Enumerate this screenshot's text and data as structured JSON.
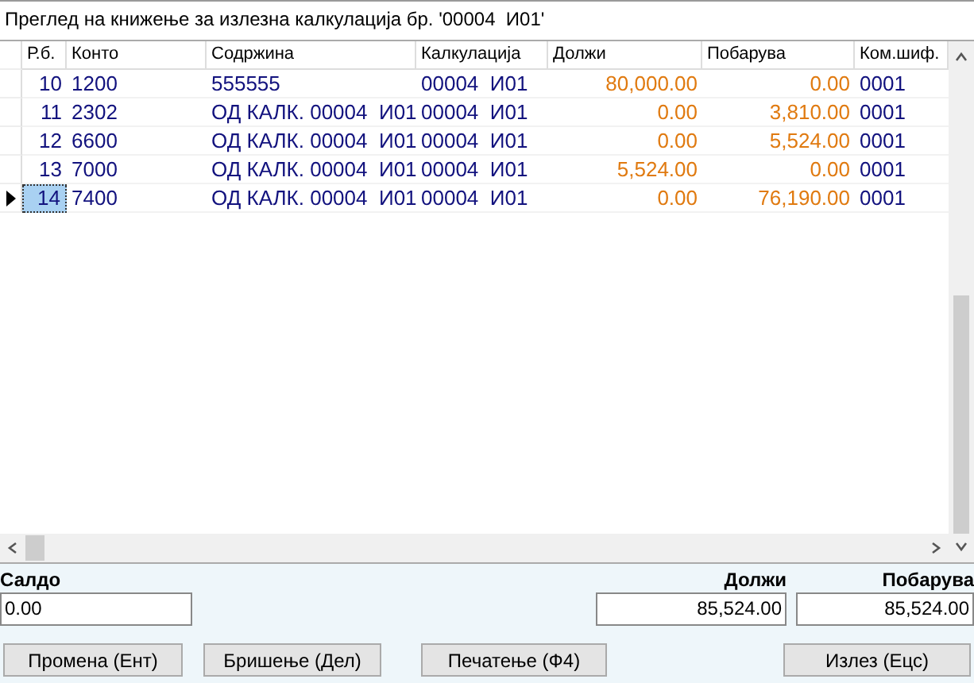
{
  "title": "Преглед на книжење за излезна калкулација бр. '00004  И01'",
  "table": {
    "columns": [
      "Р.б.",
      "Конто",
      "Содржина",
      "Калкулација",
      "Должи",
      "Побарува",
      "Ком.шиф."
    ],
    "rows": [
      {
        "cells": [
          "10",
          "1200",
          "555555",
          "00004  И01",
          "80,000.00",
          "0.00",
          "0001"
        ],
        "selected": false
      },
      {
        "cells": [
          "11",
          "2302",
          "ОД КАЛК. 00004  И01",
          "00004  И01",
          "0.00",
          "3,810.00",
          "0001"
        ],
        "selected": false
      },
      {
        "cells": [
          "12",
          "6600",
          "ОД КАЛК. 00004  И01",
          "00004  И01",
          "0.00",
          "5,524.00",
          "0001"
        ],
        "selected": false
      },
      {
        "cells": [
          "13",
          "7000",
          "ОД КАЛК. 00004  И01",
          "00004  И01",
          "5,524.00",
          "0.00",
          "0001"
        ],
        "selected": false
      },
      {
        "cells": [
          "14",
          "7400",
          "ОД КАЛК. 00004  И01",
          "00004  И01",
          "0.00",
          "76,190.00",
          "0001"
        ],
        "selected": true
      }
    ]
  },
  "totals": [
    {
      "label": "Салдо",
      "value": "0.00"
    },
    {
      "label": "Должи",
      "value": "85,524.00"
    },
    {
      "label": "Побарува",
      "value": "85,524.00"
    }
  ],
  "buttons": [
    "Промена (Ент)",
    "Бришење (Дел)",
    "Печатење (Ф4)",
    "Излез (Ецс)"
  ]
}
